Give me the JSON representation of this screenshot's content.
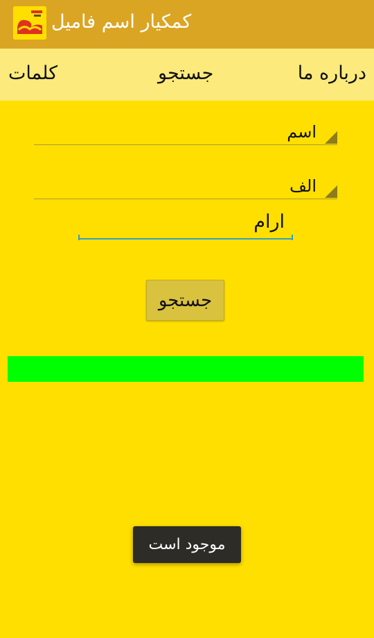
{
  "app_bar": {
    "title": "کمکیار اسم فامیل",
    "logo_icon": "app-logo-icon",
    "background": "#DBA524"
  },
  "tabs": [
    {
      "id": "words",
      "label": "کلمات"
    },
    {
      "id": "search",
      "label": "جستجو"
    },
    {
      "id": "about",
      "label": "درباره ما"
    }
  ],
  "form": {
    "category_selected": "اسم",
    "letter_selected": "الف",
    "word_value": "ارام",
    "search_button_label": "جستجو"
  },
  "result": {
    "status_color": "#00FF00"
  },
  "toast": {
    "message": "موجود است"
  },
  "colors": {
    "background": "#FFDF00",
    "tab_bar": "#FCEA7C",
    "input_underline": "#2FA0C8"
  }
}
